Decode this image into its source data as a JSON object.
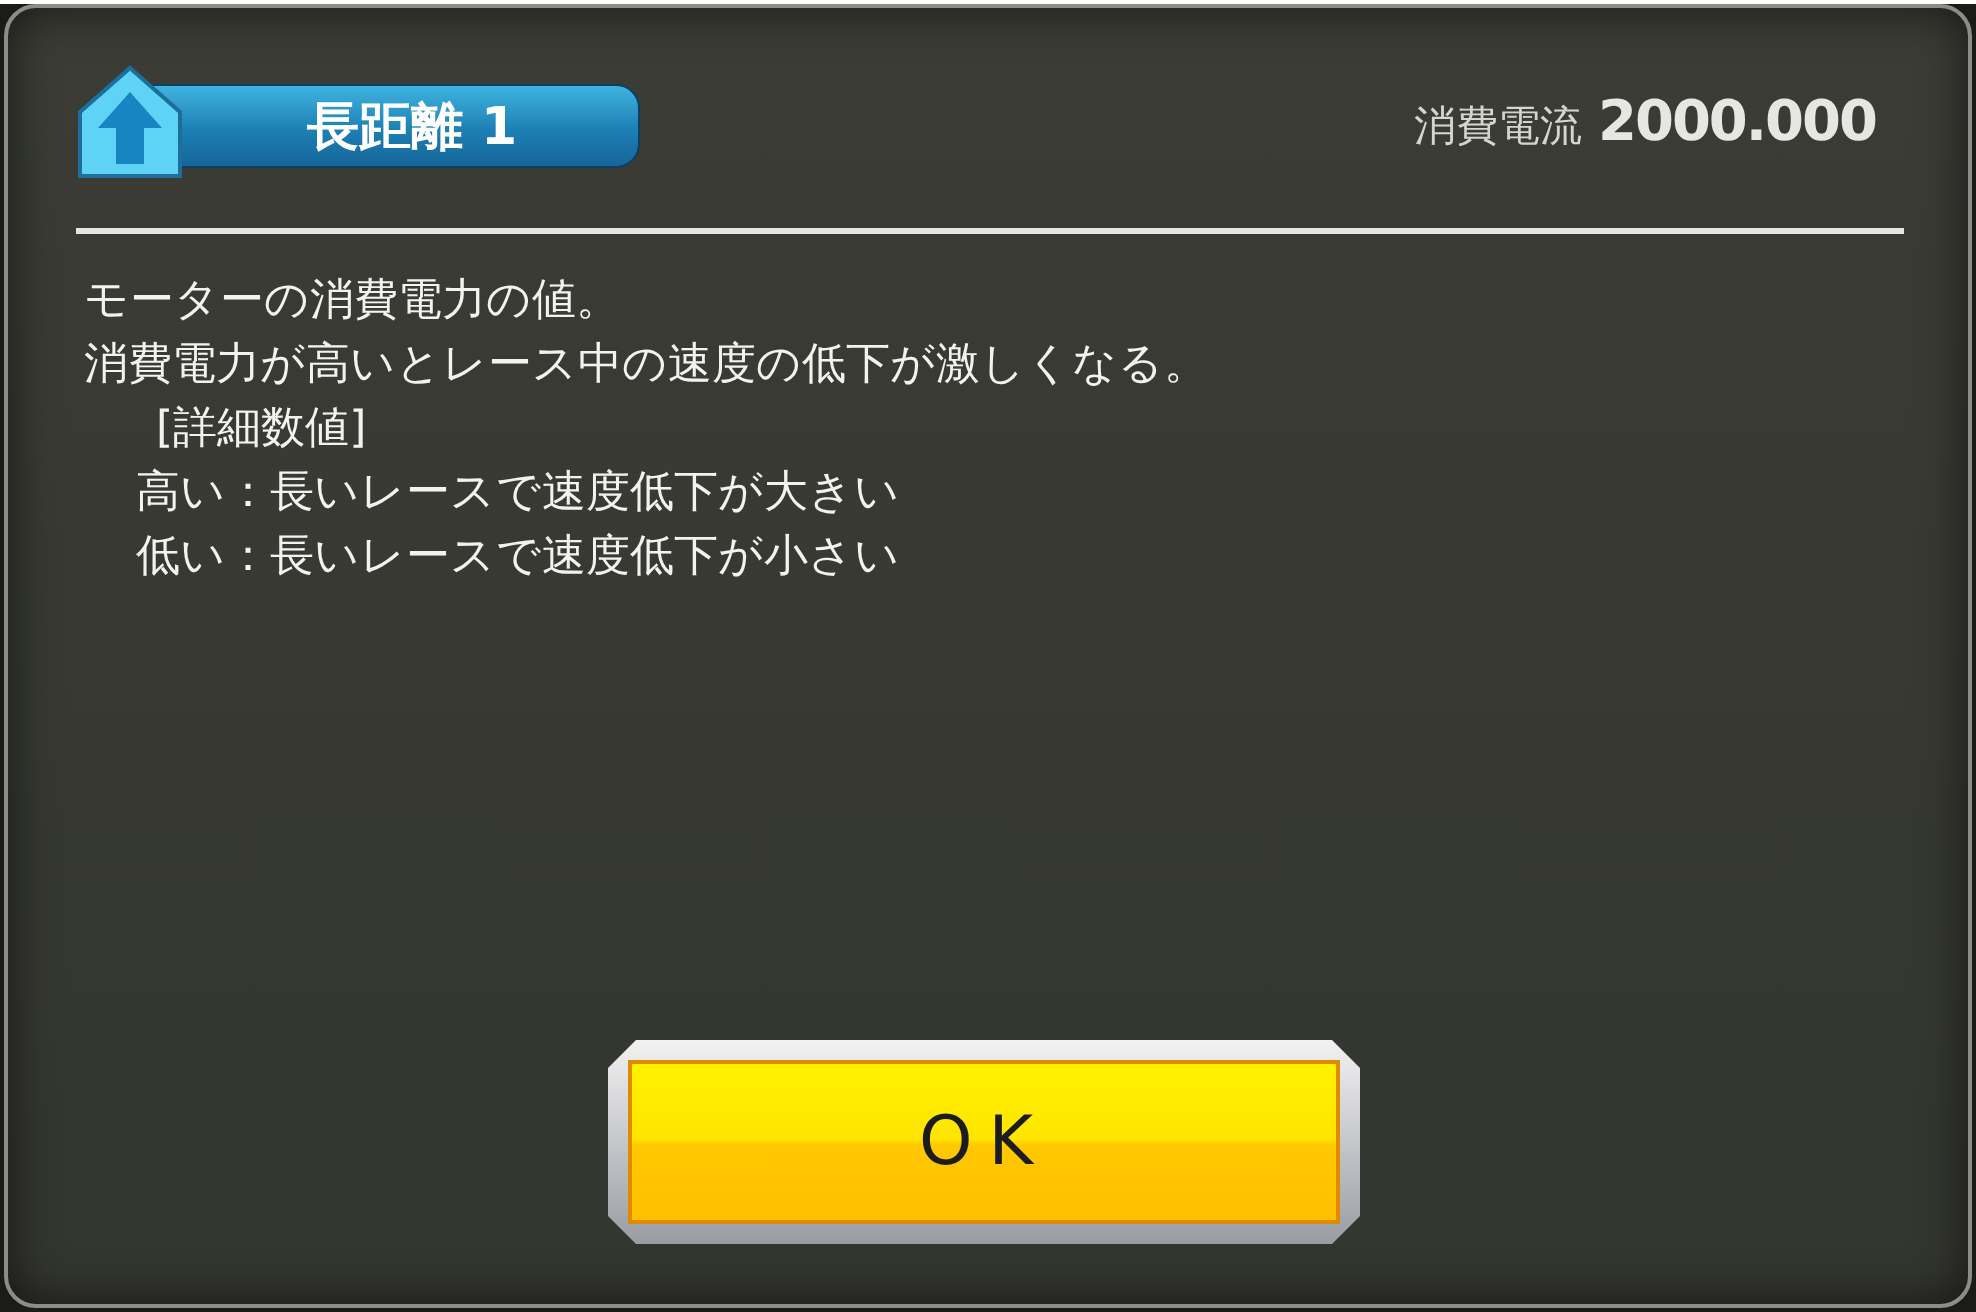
{
  "header": {
    "title": "長距離 1",
    "stat_label": "消費電流",
    "stat_value": "2000.000"
  },
  "description": [
    {
      "kind": "plain",
      "text": "モーターの消費電力の値。"
    },
    {
      "kind": "plain",
      "text": "消費電力が高いとレース中の速度の低下が激しくなる。"
    },
    {
      "kind": "section",
      "text": "[詳細数値]"
    },
    {
      "kind": "detail",
      "text": "高い：長いレースで速度低下が大きい"
    },
    {
      "kind": "detail",
      "text": "低い：長いレースで速度低下が小さい"
    }
  ],
  "buttons": [
    {
      "label": "OK"
    }
  ]
}
